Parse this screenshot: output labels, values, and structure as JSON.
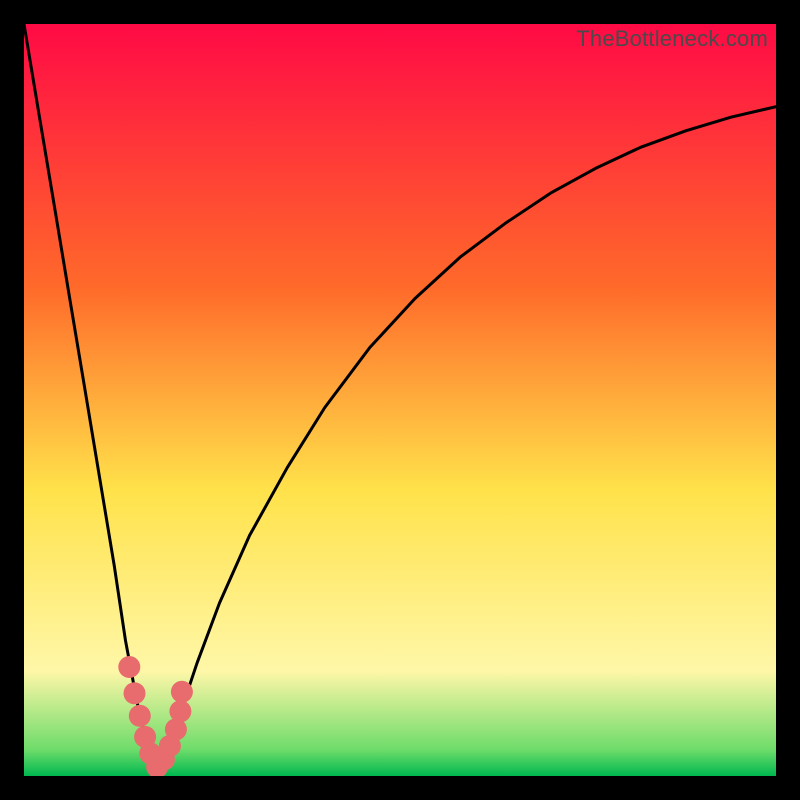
{
  "watermark": "TheBottleneck.com",
  "colors": {
    "black": "#000000",
    "curve": "#000000",
    "marker": "#e86b6e",
    "grad_top": "#ff0a45",
    "grad_orange": "#ff6a2a",
    "grad_yellow": "#ffe24a",
    "grad_paleyellow": "#fff7a8",
    "grad_green": "#00d25a"
  },
  "chart_data": {
    "type": "line",
    "title": "",
    "xlabel": "",
    "ylabel": "",
    "xlim": [
      0,
      100
    ],
    "ylim": [
      0,
      100
    ],
    "series": [
      {
        "name": "curve",
        "x": [
          0,
          2,
          4,
          6,
          8,
          10,
          12,
          13.5,
          15,
          16,
          17,
          17.7,
          18.5,
          19.5,
          21,
          23,
          26,
          30,
          35,
          40,
          46,
          52,
          58,
          64,
          70,
          76,
          82,
          88,
          94,
          100
        ],
        "y": [
          100,
          88,
          76,
          64,
          52,
          40,
          28,
          18,
          10,
          5.5,
          2.5,
          1.2,
          2.0,
          4.5,
          9,
          15,
          23,
          32,
          41,
          49,
          57,
          63.5,
          69,
          73.5,
          77.5,
          80.8,
          83.6,
          85.8,
          87.6,
          89.0
        ]
      }
    ],
    "markers": {
      "name": "highlight-points",
      "x": [
        14.0,
        14.7,
        15.4,
        16.1,
        16.8,
        17.7,
        18.6,
        19.4,
        20.2,
        20.8,
        21.0
      ],
      "y": [
        14.5,
        11.0,
        8.0,
        5.2,
        3.0,
        1.2,
        2.2,
        4.0,
        6.2,
        8.6,
        11.2
      ]
    },
    "background_gradient_stops": [
      {
        "pos": 0.0,
        "color": "#ff0a45"
      },
      {
        "pos": 0.35,
        "color": "#ff6a2a"
      },
      {
        "pos": 0.62,
        "color": "#ffe24a"
      },
      {
        "pos": 0.86,
        "color": "#fff7a8"
      },
      {
        "pos": 0.965,
        "color": "#6edc6a"
      },
      {
        "pos": 1.0,
        "color": "#00b850"
      }
    ]
  }
}
